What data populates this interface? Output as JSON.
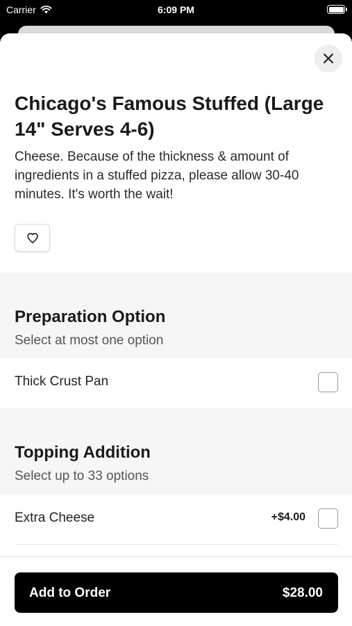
{
  "status_bar": {
    "carrier": "Carrier",
    "time": "6:09 PM"
  },
  "item": {
    "title": "Chicago's Famous Stuffed (Large 14\" Serves 4-6)",
    "description": "Cheese. Because of the thickness & amount of ingredients in a stuffed pizza, please allow 30-40 minutes. It's worth the wait!"
  },
  "sections": [
    {
      "title": "Preparation Option",
      "subtitle": "Select at most one option",
      "options": [
        {
          "label": "Thick Crust Pan",
          "price": ""
        }
      ]
    },
    {
      "title": "Topping Addition",
      "subtitle": "Select up to 33 options",
      "options": [
        {
          "label": "Extra Cheese",
          "price": "+$4.00"
        }
      ]
    }
  ],
  "footer": {
    "button_label": "Add to Order",
    "total": "$28.00"
  },
  "icons": {
    "close": "close-icon",
    "favorite": "heart-icon",
    "wifi": "wifi-icon"
  }
}
